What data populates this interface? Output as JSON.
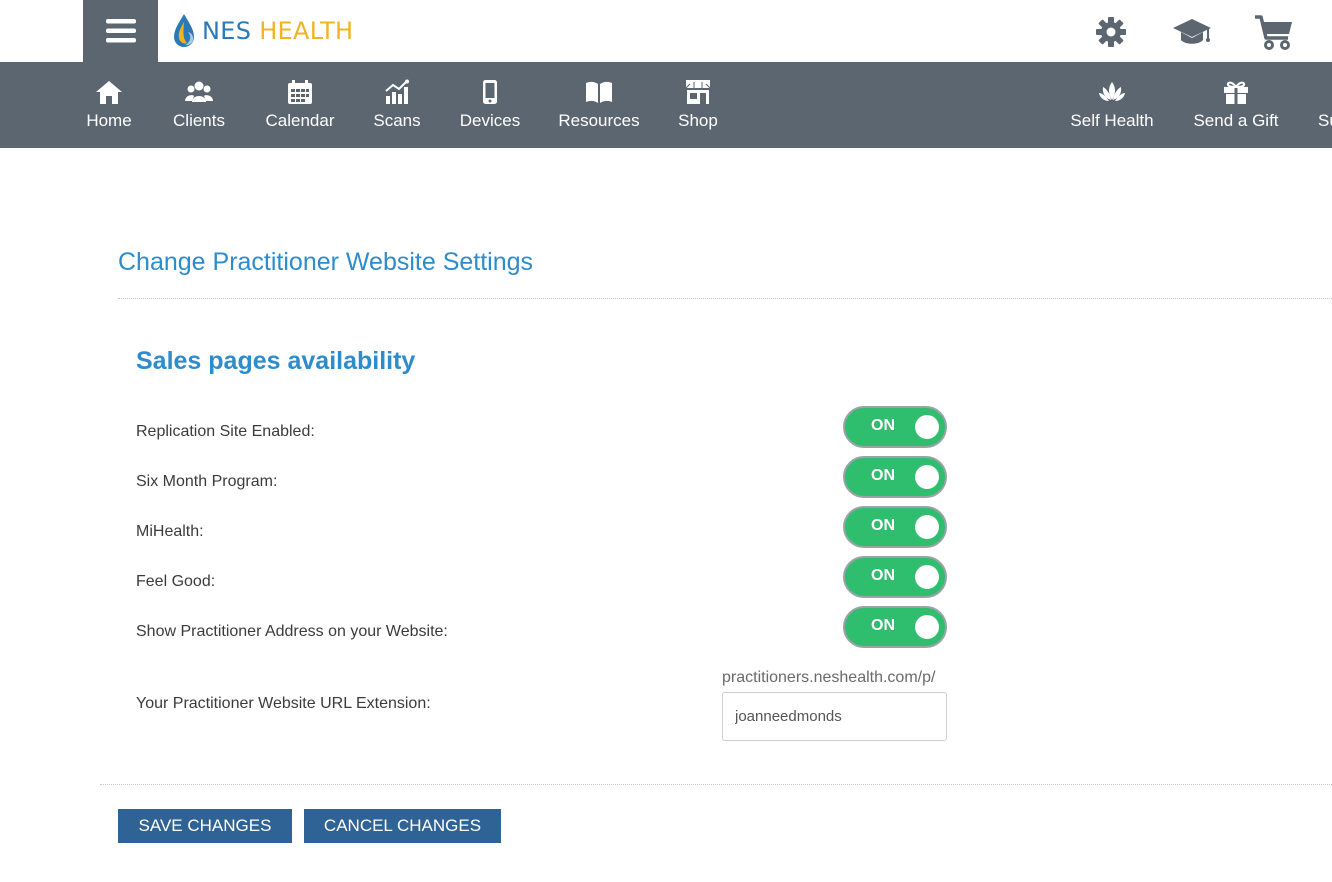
{
  "header": {
    "logo_nes": "NES",
    "logo_health": "HEALTH",
    "icons": [
      "gear-icon",
      "graduation-cap-icon",
      "cart-icon"
    ]
  },
  "nav": {
    "items": [
      {
        "label": "Home",
        "icon": "home-icon"
      },
      {
        "label": "Clients",
        "icon": "clients-icon"
      },
      {
        "label": "Calendar",
        "icon": "calendar-icon"
      },
      {
        "label": "Scans",
        "icon": "scans-icon"
      },
      {
        "label": "Devices",
        "icon": "device-icon"
      },
      {
        "label": "Resources",
        "icon": "book-icon"
      },
      {
        "label": "Shop",
        "icon": "shop-icon"
      },
      {
        "label": "Self Health",
        "icon": "lotus-icon"
      },
      {
        "label": "Send a Gift",
        "icon": "gift-icon"
      },
      {
        "label": "Su",
        "icon": ""
      }
    ]
  },
  "page": {
    "title": "Change Practitioner Website Settings",
    "section_title": "Sales pages availability"
  },
  "settings": [
    {
      "label": "Replication Site Enabled:",
      "state": "ON"
    },
    {
      "label": "Six Month Program:",
      "state": "ON"
    },
    {
      "label": "MiHealth:",
      "state": "ON"
    },
    {
      "label": "Feel Good:",
      "state": "ON"
    },
    {
      "label": "Show Practitioner Address on your Website:",
      "state": "ON"
    }
  ],
  "url": {
    "label": "Your Practitioner Website URL Extension:",
    "prefix": "practitioners.neshealth.com/p/",
    "value": "joanneedmonds"
  },
  "buttons": {
    "save": "SAVE CHANGES",
    "cancel": "CANCEL CHANGES"
  },
  "colors": {
    "brand_blue": "#2d8ccb",
    "nav_gray": "#5b6670",
    "toggle_green": "#2fbe6e",
    "button_blue": "#2f6395",
    "logo_yellow": "#f0b323"
  }
}
